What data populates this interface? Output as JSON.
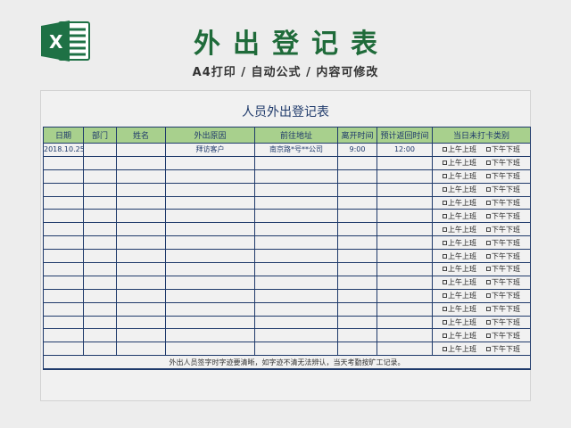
{
  "header": {
    "title": "外出登记表",
    "subtitle": "A4打印 / 自动公式 / 内容可修改",
    "logo_icon": "excel-icon",
    "logo_color": "#1e7145"
  },
  "sheet": {
    "title": "人员外出登记表",
    "columns": [
      "日期",
      "部门",
      "姓名",
      "外出原因",
      "前往地址",
      "离开时间",
      "预计返回时间",
      "当日未打卡类别"
    ],
    "checkbox_options": [
      "上午上班",
      "下午下班"
    ],
    "rows": [
      [
        "2018.10.25",
        "",
        "",
        "拜访客户",
        "南京路*号**公司",
        "9:00",
        "12:00"
      ],
      [
        "",
        "",
        "",
        "",
        "",
        "",
        ""
      ],
      [
        "",
        "",
        "",
        "",
        "",
        "",
        ""
      ],
      [
        "",
        "",
        "",
        "",
        "",
        "",
        ""
      ],
      [
        "",
        "",
        "",
        "",
        "",
        "",
        ""
      ],
      [
        "",
        "",
        "",
        "",
        "",
        "",
        ""
      ],
      [
        "",
        "",
        "",
        "",
        "",
        "",
        ""
      ],
      [
        "",
        "",
        "",
        "",
        "",
        "",
        ""
      ],
      [
        "",
        "",
        "",
        "",
        "",
        "",
        ""
      ],
      [
        "",
        "",
        "",
        "",
        "",
        "",
        ""
      ],
      [
        "",
        "",
        "",
        "",
        "",
        "",
        ""
      ],
      [
        "",
        "",
        "",
        "",
        "",
        "",
        ""
      ],
      [
        "",
        "",
        "",
        "",
        "",
        "",
        ""
      ],
      [
        "",
        "",
        "",
        "",
        "",
        "",
        ""
      ],
      [
        "",
        "",
        "",
        "",
        "",
        "",
        ""
      ],
      [
        "",
        "",
        "",
        "",
        "",
        "",
        ""
      ]
    ],
    "footer": "外出人员签字时字迹要清晰，如字迹不清无法辨认，当天考勤按旷工记录。"
  },
  "colors": {
    "header_fill": "#a8d08d",
    "border": "#1f3a6b",
    "title_green": "#1f6b3a"
  }
}
